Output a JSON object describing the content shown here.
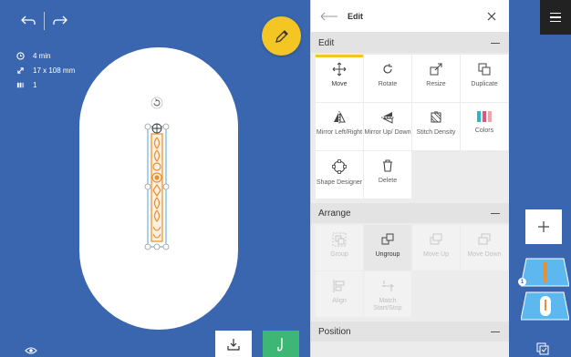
{
  "canvas": {
    "info": {
      "time": "4 min",
      "size": "17 x 108 mm",
      "colors": "1"
    }
  },
  "panel": {
    "title": "Edit",
    "sections": {
      "edit": {
        "title": "Edit",
        "tools": [
          {
            "label": "Move",
            "icon": "move-icon"
          },
          {
            "label": "Rotate",
            "icon": "rotate-icon"
          },
          {
            "label": "Resize",
            "icon": "resize-icon"
          },
          {
            "label": "Duplicate",
            "icon": "duplicate-icon"
          },
          {
            "label": "Mirror Left/Right",
            "icon": "mirror-left-right-icon"
          },
          {
            "label": "Mirror Up/ Down",
            "icon": "mirror-up-down-icon"
          },
          {
            "label": "Stitch Density",
            "icon": "stitch-density-icon"
          },
          {
            "label": "Colors",
            "icon": "colors-icon"
          },
          {
            "label": "Shape Designer",
            "icon": "shape-designer-icon"
          },
          {
            "label": "Delete",
            "icon": "delete-icon"
          }
        ]
      },
      "arrange": {
        "title": "Arrange",
        "tools": [
          {
            "label": "Group",
            "icon": "group-icon"
          },
          {
            "label": "Ungroup",
            "icon": "ungroup-icon"
          },
          {
            "label": "Move Up",
            "icon": "move-up-icon"
          },
          {
            "label": "Move Down",
            "icon": "move-down-icon"
          },
          {
            "label": "Align",
            "icon": "align-icon"
          },
          {
            "label": "Match Start/Stop",
            "icon": "match-start-stop-icon"
          }
        ]
      },
      "position": {
        "title": "Position"
      }
    }
  },
  "rail": {
    "layer_badge": "1"
  },
  "colors": {
    "canvas_bg": "#3a66b0",
    "accent_yellow": "#f3c623",
    "stitch_green": "#3db676",
    "embroidery_orange": "#e8902e",
    "selection_blue": "#4aa7e0"
  }
}
